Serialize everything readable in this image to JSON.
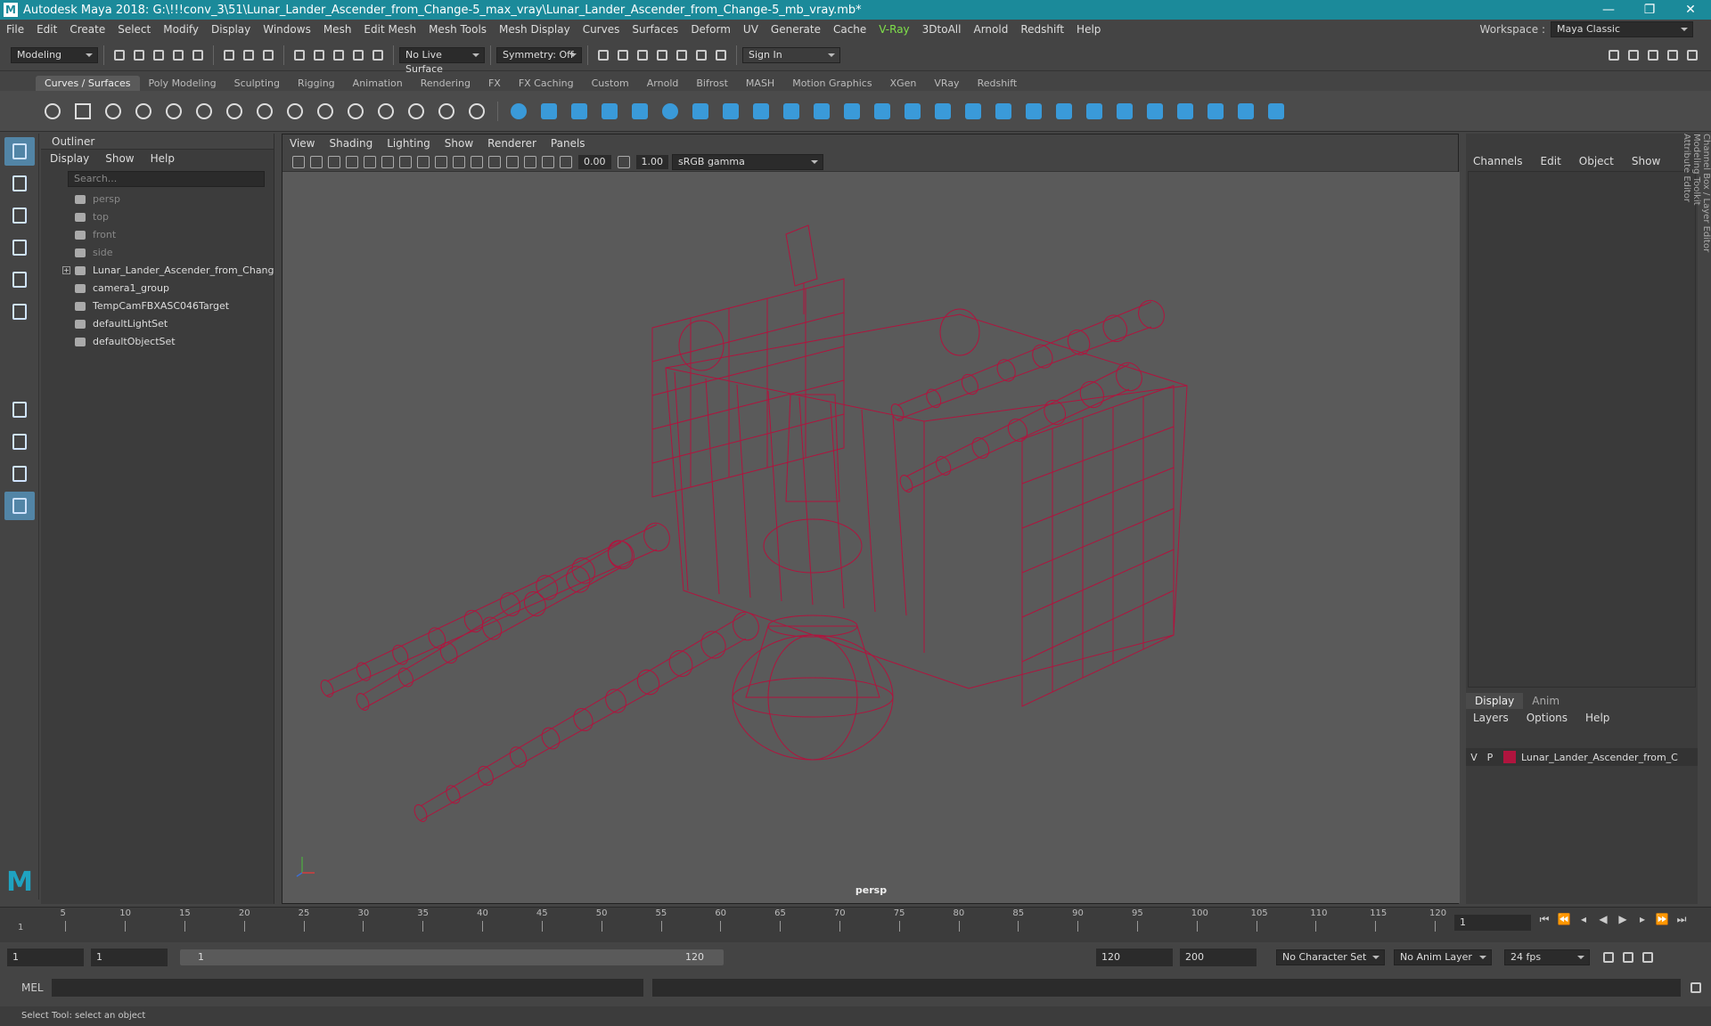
{
  "window": {
    "title": "Autodesk Maya 2018: G:\\!!!conv_3\\51\\Lunar_Lander_Ascender_from_Change-5_max_vray\\Lunar_Lander_Ascender_from_Change-5_mb_vray.mb*",
    "logo": "M",
    "min": "—",
    "max": "❐",
    "close": "✕"
  },
  "menu": [
    "File",
    "Edit",
    "Create",
    "Select",
    "Modify",
    "Display",
    "Windows",
    "Mesh",
    "Edit Mesh",
    "Mesh Tools",
    "Mesh Display",
    "Curves",
    "Surfaces",
    "Deform",
    "UV",
    "Generate",
    "Cache",
    "V-Ray",
    "3DtoAll",
    "Arnold",
    "Redshift",
    "Help"
  ],
  "workspace": {
    "label": "Workspace :",
    "value": "Maya Classic"
  },
  "status": {
    "mode": "Modeling",
    "live": "No Live Surface",
    "symmetry": "Symmetry: Off",
    "signin": "Sign In"
  },
  "shelf_tabs": [
    "Curves / Surfaces",
    "Poly Modeling",
    "Sculpting",
    "Rigging",
    "Animation",
    "Rendering",
    "FX",
    "FX Caching",
    "Custom",
    "Arnold",
    "Bifrost",
    "MASH",
    "Motion Graphics",
    "XGen",
    "VRay",
    "Redshift"
  ],
  "outliner": {
    "title": "Outliner",
    "menu": [
      "Display",
      "Show",
      "Help"
    ],
    "search_placeholder": "Search...",
    "items": [
      {
        "label": "persp",
        "dim": true
      },
      {
        "label": "top",
        "dim": true
      },
      {
        "label": "front",
        "dim": true
      },
      {
        "label": "side",
        "dim": true
      },
      {
        "label": "Lunar_Lander_Ascender_from_Chang",
        "dim": false,
        "expand": "+"
      },
      {
        "label": "camera1_group",
        "dim": false
      },
      {
        "label": "TempCamFBXASC046Target",
        "dim": false
      },
      {
        "label": "defaultLightSet",
        "dim": false
      },
      {
        "label": "defaultObjectSet",
        "dim": false
      }
    ]
  },
  "viewport": {
    "menu": [
      "View",
      "Shading",
      "Lighting",
      "Show",
      "Renderer",
      "Panels"
    ],
    "exposure": "0.00",
    "gamma": "1.00",
    "colorspace": "sRGB gamma",
    "camera": "persp",
    "wire_color": "#b0143e"
  },
  "channelbox": {
    "menu": [
      "Channels",
      "Edit",
      "Object",
      "Show"
    ]
  },
  "layers": {
    "tabs": [
      "Display",
      "Anim"
    ],
    "menu": [
      "Layers",
      "Options",
      "Help"
    ],
    "layer": {
      "v": "V",
      "p": "P",
      "name": "Lunar_Lander_Ascender_from_C",
      "color": "#b0143e"
    }
  },
  "side_tabs": [
    "Channel Box / Layer Editor",
    "Modeling Toolkit",
    "Attribute Editor"
  ],
  "timeline": {
    "labels": [
      "5",
      "10",
      "15",
      "20",
      "25",
      "30",
      "35",
      "40",
      "45",
      "50",
      "55",
      "60",
      "65",
      "70",
      "75",
      "80",
      "85",
      "90",
      "95",
      "100",
      "105",
      "110",
      "115",
      "120"
    ],
    "start_label": "1",
    "current": "1"
  },
  "range": {
    "start": "1",
    "start2": "1",
    "slider_start": "1",
    "slider_end": "120",
    "end": "120",
    "end2": "200",
    "charset": "No Character Set",
    "animlayer": "No Anim Layer",
    "fps": "24 fps"
  },
  "mel": {
    "label": "MEL"
  },
  "help": "Select Tool: select an object"
}
